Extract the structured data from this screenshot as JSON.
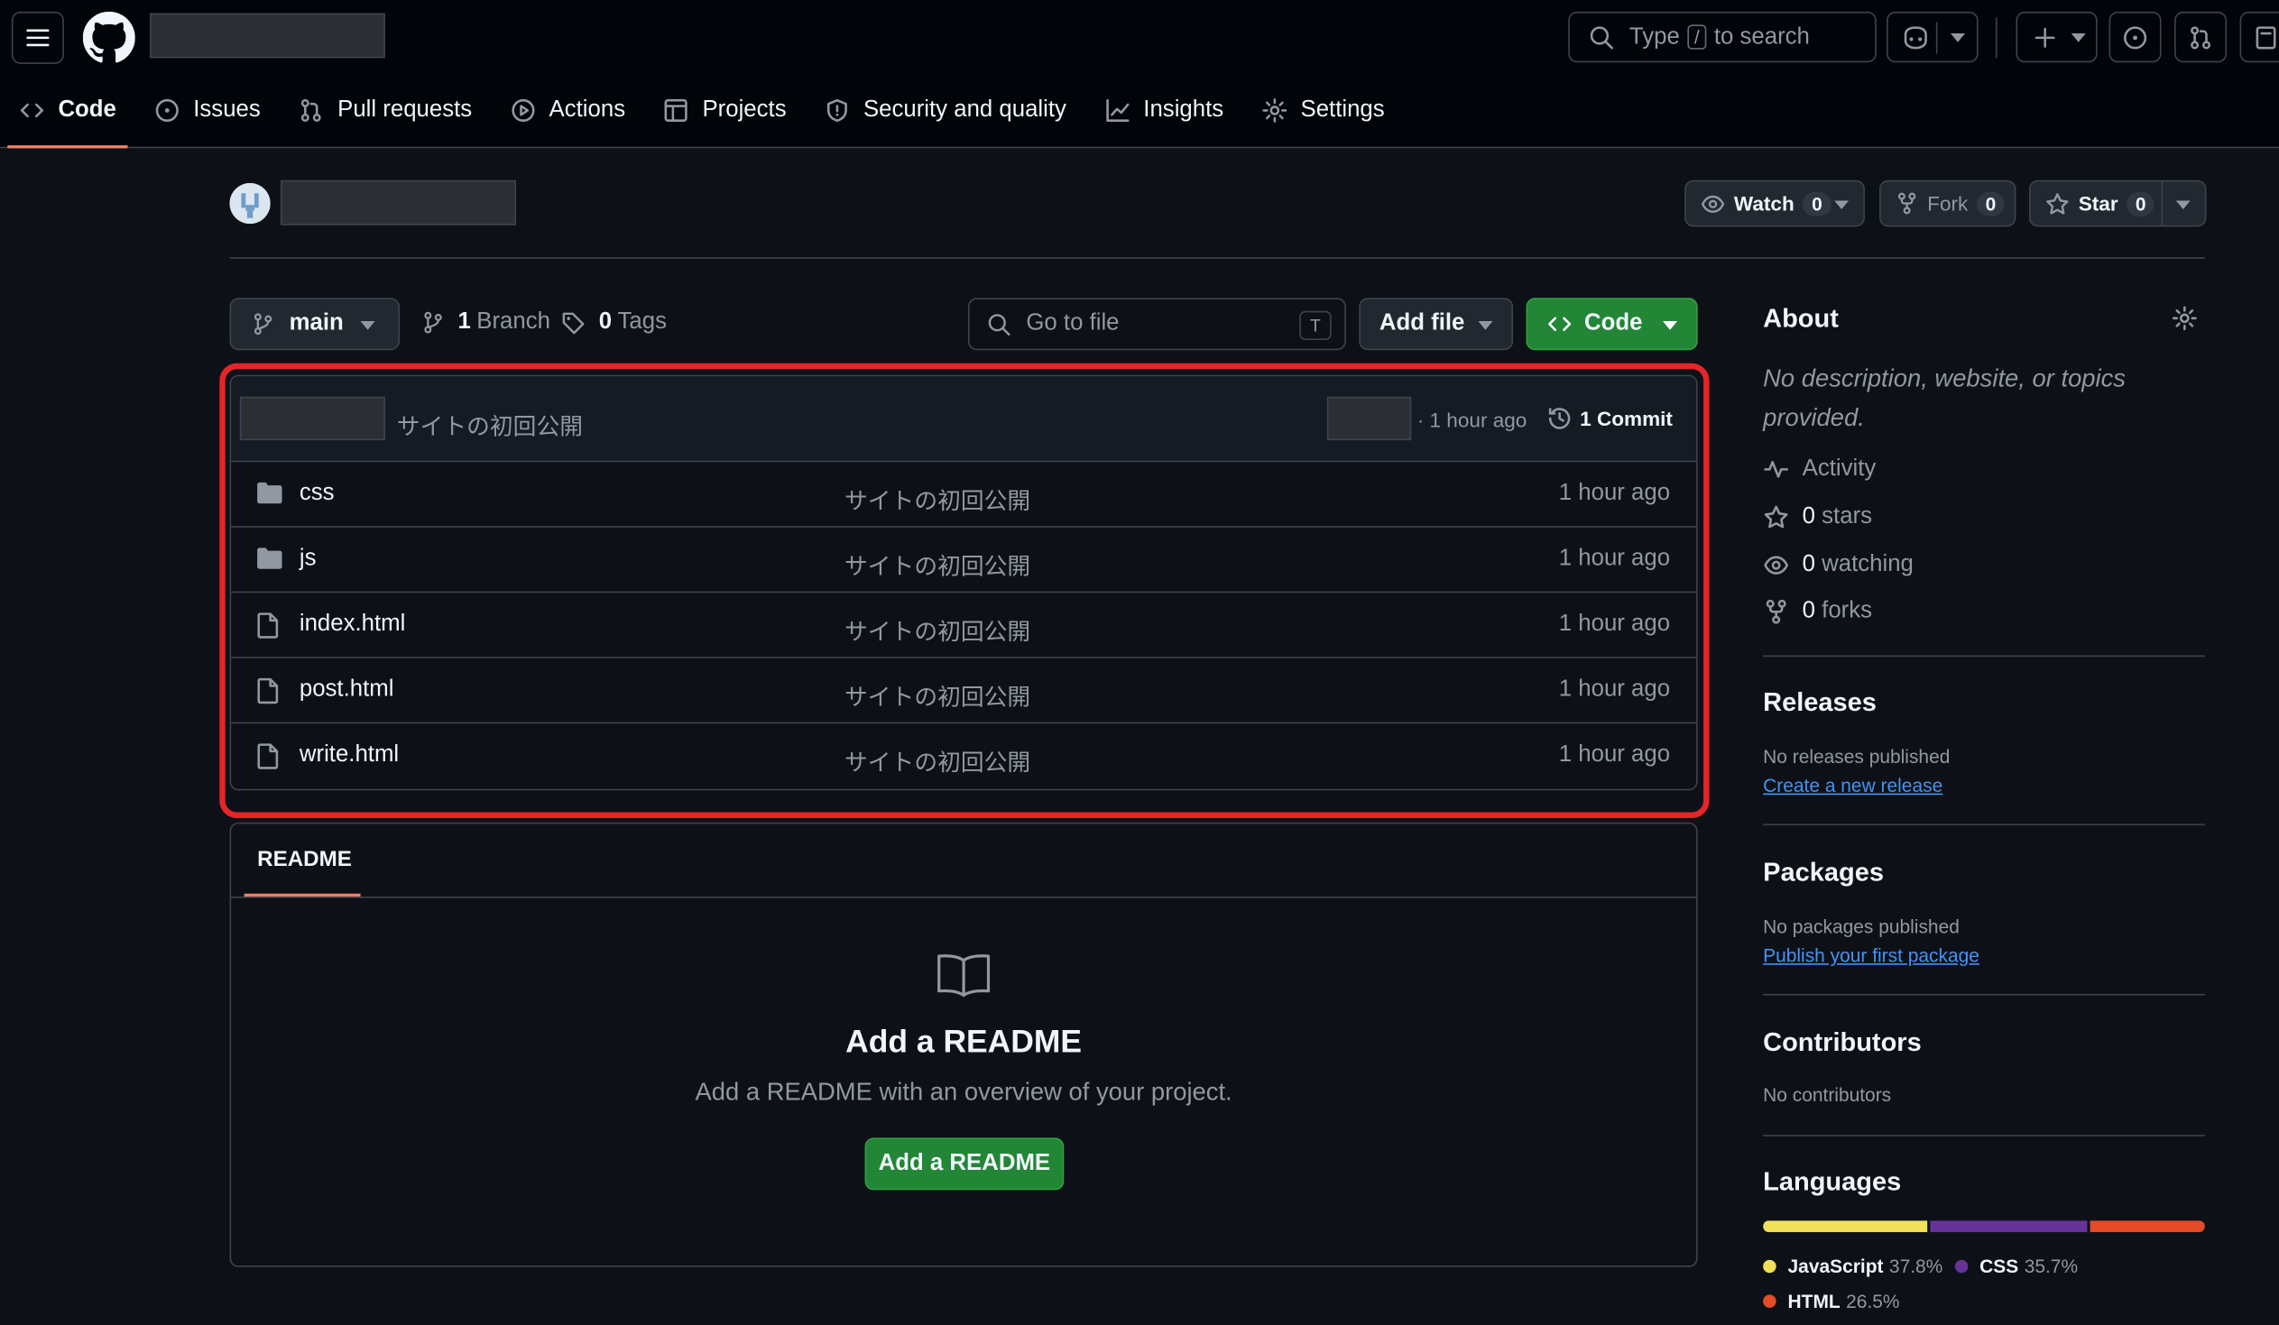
{
  "header": {
    "search_prefix": "Type",
    "search_key": "/",
    "search_suffix": "to search"
  },
  "tabs": [
    {
      "label": "Code"
    },
    {
      "label": "Issues"
    },
    {
      "label": "Pull requests"
    },
    {
      "label": "Actions"
    },
    {
      "label": "Projects"
    },
    {
      "label": "Security and quality"
    },
    {
      "label": "Insights"
    },
    {
      "label": "Settings"
    }
  ],
  "repo_actions": {
    "watch_label": "Watch",
    "watch_count": "0",
    "fork_label": "Fork",
    "fork_count": "0",
    "star_label": "Star",
    "star_count": "0"
  },
  "toolbar": {
    "branch": "main",
    "branch_count": "1",
    "branch_label": "Branch",
    "tag_count": "0",
    "tag_label": "Tags",
    "goto_placeholder": "Go to file",
    "goto_key": "T",
    "add_file": "Add file",
    "code": "Code"
  },
  "latest_commit": {
    "message": "サイトの初回公開",
    "time": "· 1 hour ago",
    "commits": "1 Commit"
  },
  "files": [
    {
      "type": "folder",
      "name": "css",
      "message": "サイトの初回公開",
      "time": "1 hour ago"
    },
    {
      "type": "folder",
      "name": "js",
      "message": "サイトの初回公開",
      "time": "1 hour ago"
    },
    {
      "type": "file",
      "name": "index.html",
      "message": "サイトの初回公開",
      "time": "1 hour ago"
    },
    {
      "type": "file",
      "name": "post.html",
      "message": "サイトの初回公開",
      "time": "1 hour ago"
    },
    {
      "type": "file",
      "name": "write.html",
      "message": "サイトの初回公開",
      "time": "1 hour ago"
    }
  ],
  "readme": {
    "tab": "README",
    "title": "Add a README",
    "subtitle": "Add a README with an overview of your project.",
    "button": "Add a README"
  },
  "sidebar": {
    "about_title": "About",
    "about_desc": "No description, website, or topics provided.",
    "activity": "Activity",
    "stars_count": "0",
    "stars_label": "stars",
    "watching_count": "0",
    "watching_label": "watching",
    "forks_count": "0",
    "forks_label": "forks",
    "releases_title": "Releases",
    "releases_text": "No releases published",
    "releases_link": "Create a new release",
    "packages_title": "Packages",
    "packages_text": "No packages published",
    "packages_link": "Publish your first package",
    "contributors_title": "Contributors",
    "contributors_text": "No contributors",
    "languages_title": "Languages",
    "languages": [
      {
        "name": "JavaScript",
        "percent": "37.8%",
        "share": 37.8,
        "color": "#f1e05a"
      },
      {
        "name": "CSS",
        "percent": "35.7%",
        "share": 35.7,
        "color": "#663399"
      },
      {
        "name": "HTML",
        "percent": "26.5%",
        "share": 26.5,
        "color": "#e34c26"
      }
    ]
  }
}
